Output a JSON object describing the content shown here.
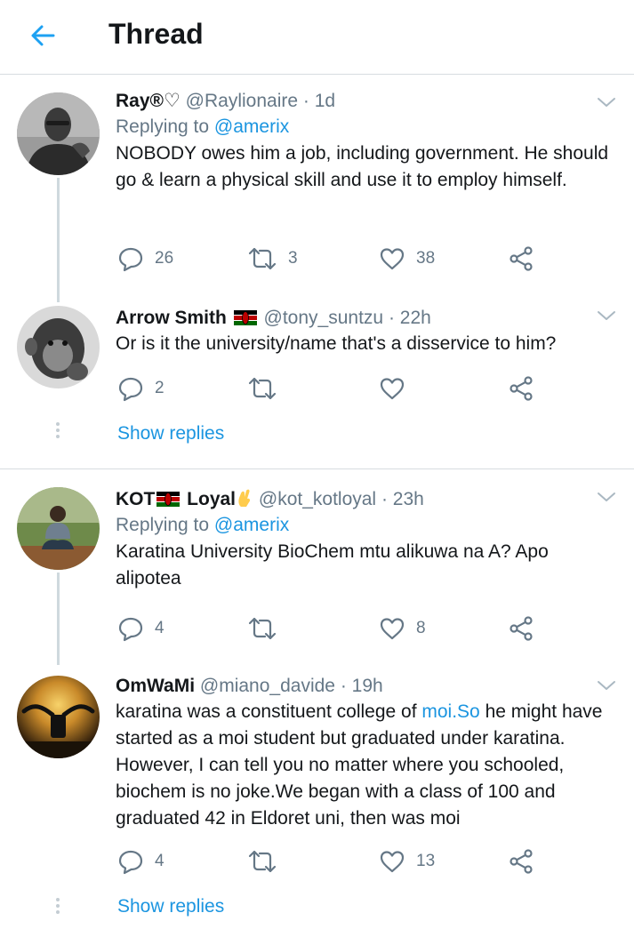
{
  "header": {
    "title": "Thread"
  },
  "tweets": [
    {
      "name": "Ray®♡",
      "handle": "@Raylionaire",
      "separator": "·",
      "time": "1d",
      "replying_prefix": "Replying to",
      "replying_to": "@amerix",
      "text": "NOBODY owes him a job, including government. He should go & learn a physical skill and use it to employ himself.",
      "replies": "26",
      "retweets": "3",
      "likes": "38"
    },
    {
      "name": "Arrow Smith",
      "handle": "@tony_suntzu",
      "separator": "·",
      "time": "22h",
      "text": "Or is it the university/name that's a disservice to him?",
      "replies": "2",
      "retweets": "",
      "likes": ""
    },
    {
      "name_part1": "KOT",
      "name_part2": "Loyal",
      "handle": "@kot_kotloyal",
      "separator": "·",
      "time": "23h",
      "replying_prefix": "Replying to",
      "replying_to": "@amerix",
      "text": "Karatina University BioChem mtu alikuwa na A? Apo alipotea",
      "replies": "4",
      "retweets": "",
      "likes": "8"
    },
    {
      "name": "OmWaMi",
      "handle": "@miano_davide",
      "separator": "·",
      "time": "19h",
      "text_before_link": "karatina was a constituent college of ",
      "link": "moi.So",
      "text_after_link": " he might have started as a moi student but graduated under karatina. However, I can tell you no matter where you schooled, biochem is no joke.We began with a class of 100 and graduated 42 in Eldoret uni, then was moi",
      "replies": "4",
      "retweets": "",
      "likes": "13"
    }
  ],
  "show_replies_label": "Show replies",
  "colors": {
    "accent": "#1b95e0",
    "muted": "#657786",
    "text": "#14171a",
    "divider": "#d7dce0"
  },
  "icons": [
    "back-arrow-icon",
    "chevron-down-icon",
    "reply-icon",
    "retweet-icon",
    "like-icon",
    "share-icon",
    "kenya-flag-icon",
    "crossed-fingers-icon"
  ]
}
